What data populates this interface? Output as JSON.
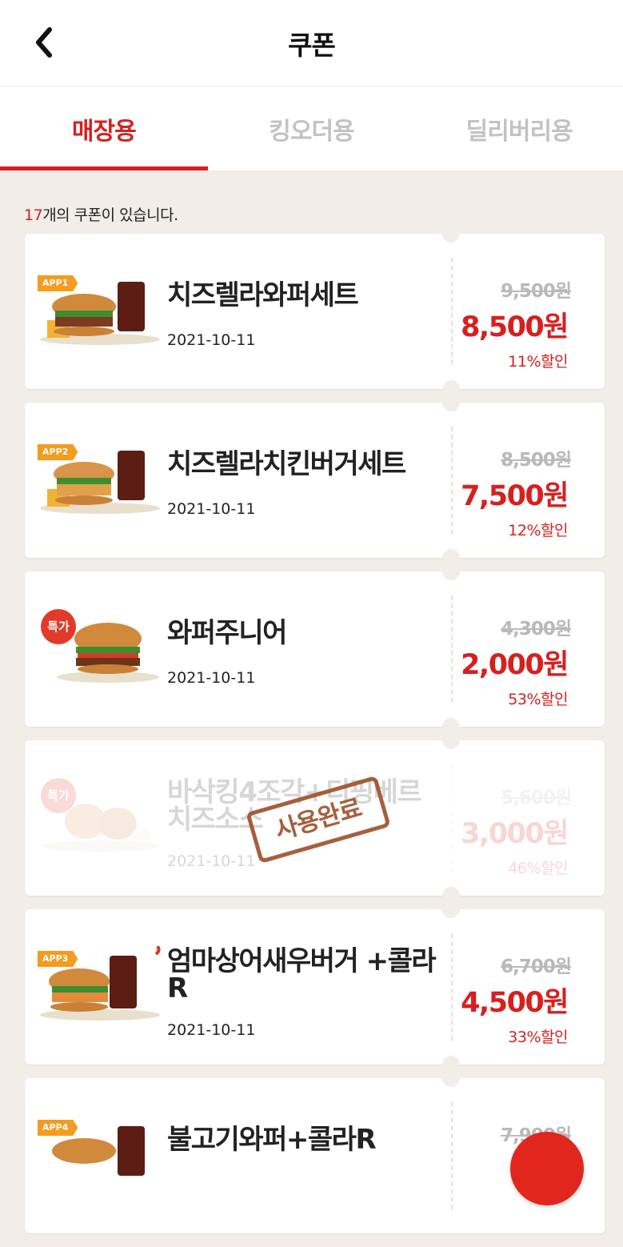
{
  "header": {
    "title": "쿠폰",
    "back_icon": "chevron-left-icon"
  },
  "tabs": [
    {
      "label": "매장용",
      "active": true
    },
    {
      "label": "킹오더용",
      "active": false
    },
    {
      "label": "딜리버리용",
      "active": false
    }
  ],
  "count": {
    "number": "17",
    "text": "개의 쿠폰이 있습니다."
  },
  "coupons": [
    {
      "badge": "APP1",
      "name": "치즈렐라와퍼세트",
      "date": "2021-10-11",
      "original_price": "9,500원",
      "price": "8,500원",
      "discount": "11%할인",
      "used": false
    },
    {
      "badge": "APP2",
      "name": "치즈렐라치킨버거세트",
      "date": "2021-10-11",
      "original_price": "8,500원",
      "price": "7,500원",
      "discount": "12%할인",
      "used": false
    },
    {
      "badge": "특가",
      "name": "와퍼주니어",
      "date": "2021-10-11",
      "original_price": "4,300원",
      "price": "2,000원",
      "discount": "53%할인",
      "used": false
    },
    {
      "badge": "특가",
      "name": "바삭킹4조각+디핑베르치즈소스",
      "date": "2021-10-11",
      "original_price": "5,600원",
      "price": "3,000원",
      "discount": "46%할인",
      "used": true,
      "stamp": "사용완료"
    },
    {
      "badge": "APP3",
      "name": "엄마상어새우버거 +콜라R",
      "date": "2021-10-11",
      "original_price": "6,700원",
      "price": "4,500원",
      "discount": "33%할인",
      "used": false
    },
    {
      "badge": "APP4",
      "name": "불고기와퍼+콜라R",
      "original_price": "7,900원",
      "used": false
    }
  ],
  "colors": {
    "accent": "#d6201f",
    "badge_orange": "#f39c1f",
    "background": "#f1ede7"
  }
}
